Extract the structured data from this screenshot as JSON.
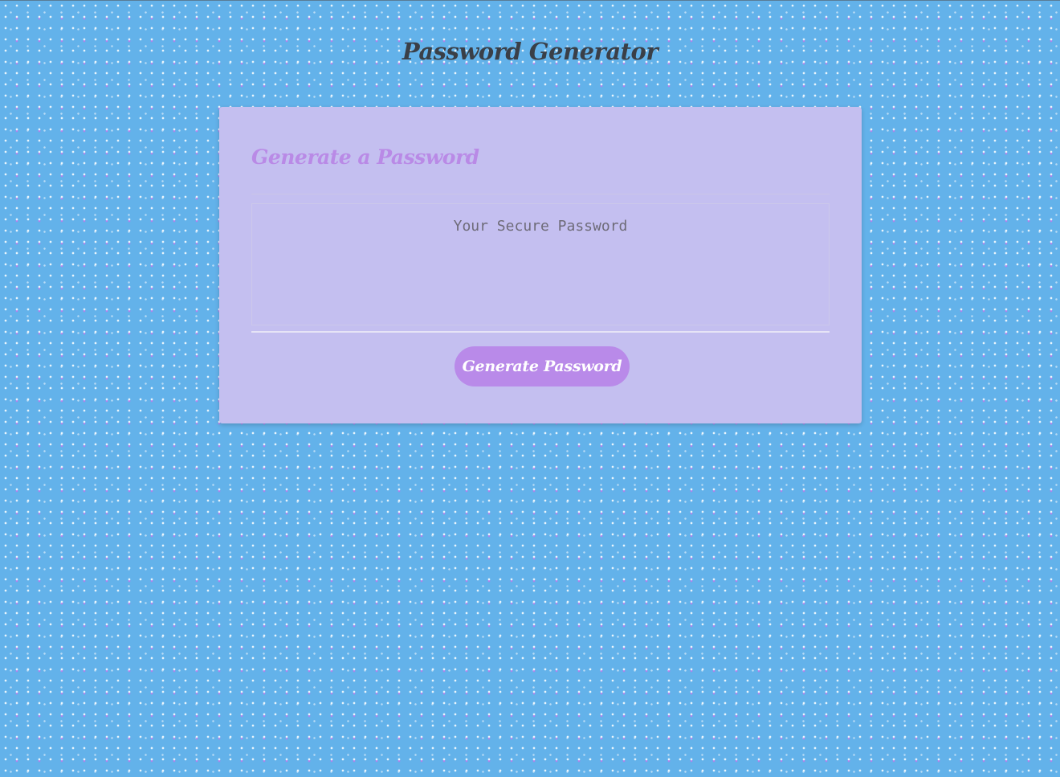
{
  "page": {
    "title": "Password Generator"
  },
  "card": {
    "header": "Generate a Password",
    "password": {
      "placeholder": "Your Secure Password",
      "value": ""
    },
    "generate_button_label": "Generate Password"
  },
  "colors": {
    "background": "#63b2ea",
    "card": "#c4bff0",
    "accent": "#b98ae9",
    "title_text": "#3a3f47"
  }
}
